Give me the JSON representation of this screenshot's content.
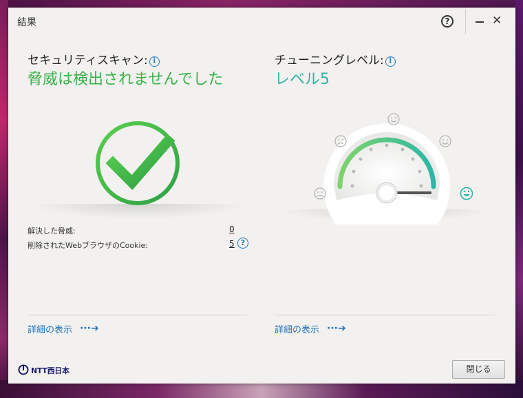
{
  "window": {
    "title": "結果"
  },
  "titlebar": {
    "help_icon": "question-circle-icon",
    "minimize_icon": "minimize-icon",
    "close_icon": "close-icon",
    "help_glyph": "?",
    "close_glyph": "✕"
  },
  "scan": {
    "title": "セキュリティスキャン:",
    "status": "脅威は検出されませんでした",
    "status_color": "#3ab24a",
    "icon": "checkmark-circle-icon",
    "rows": [
      {
        "label": "解決した脅威:",
        "value": "0"
      },
      {
        "label": "削除されたWebブラウザのCookie:",
        "value": "5"
      }
    ],
    "detail_link": "詳細の表示"
  },
  "tuning": {
    "title": "チューニングレベル:",
    "status": "レベル5",
    "status_color": "#31b3a2",
    "icon": "gauge-icon",
    "level": 5,
    "max_level": 5,
    "detail_link": "詳細の表示"
  },
  "footer": {
    "brand": "NTT西日本",
    "close_button": "閉じる"
  },
  "colors": {
    "accent_link": "#1d6fb8",
    "green": "#3ab24a",
    "teal": "#31b3a2"
  }
}
